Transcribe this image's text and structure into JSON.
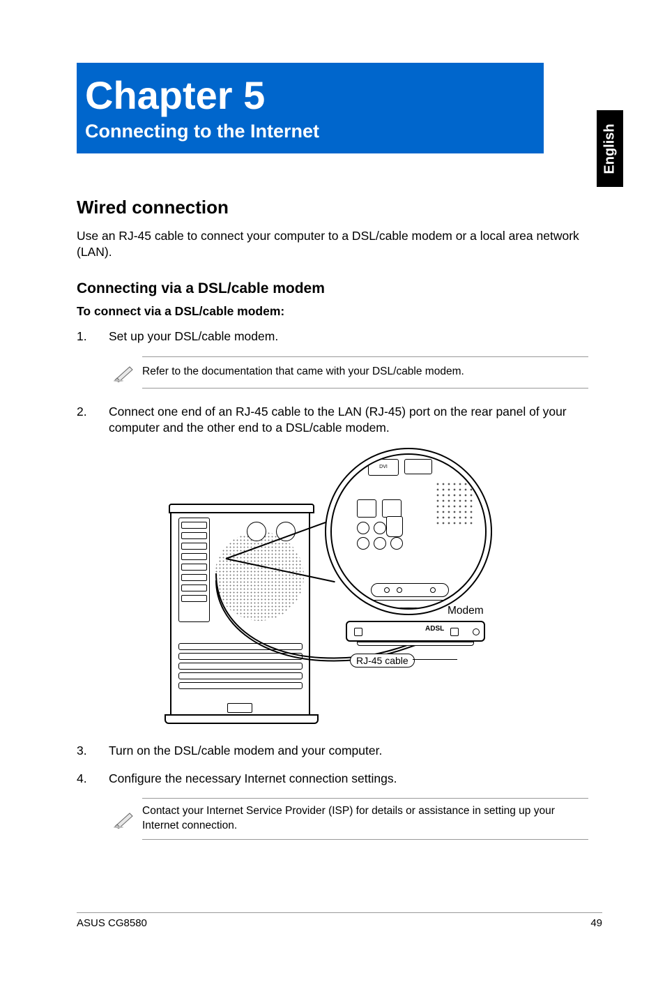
{
  "lang_tab": "English",
  "chapter": {
    "number": "Chapter 5",
    "title": "Connecting to the Internet"
  },
  "section": {
    "title": "Wired connection",
    "intro": "Use an RJ-45 cable to connect your computer to a DSL/cable modem or a local area network (LAN)."
  },
  "subsection": {
    "title": "Connecting via a DSL/cable modem",
    "lead": "To connect via a DSL/cable modem:"
  },
  "steps": {
    "s1": {
      "n": "1.",
      "t": "Set up your DSL/cable modem."
    },
    "s2": {
      "n": "2.",
      "t": "Connect one end of an RJ-45 cable to the LAN (RJ-45) port on the rear panel of your computer and the other end to a DSL/cable modem."
    },
    "s3": {
      "n": "3.",
      "t": "Turn on the DSL/cable modem and your computer."
    },
    "s4": {
      "n": "4.",
      "t": "Configure the necessary Internet connection settings."
    }
  },
  "notes": {
    "n1": "Refer to the documentation that came with your DSL/cable modem.",
    "n2": "Contact your Internet Service Provider (ISP) for details or assistance in setting up your Internet connection."
  },
  "diagram": {
    "modem_label": "Modem",
    "rj45_label": "RJ-45 cable",
    "adsl": "ADSL",
    "dvi": "DVI"
  },
  "footer": {
    "left": "ASUS CG8580",
    "right": "49"
  }
}
